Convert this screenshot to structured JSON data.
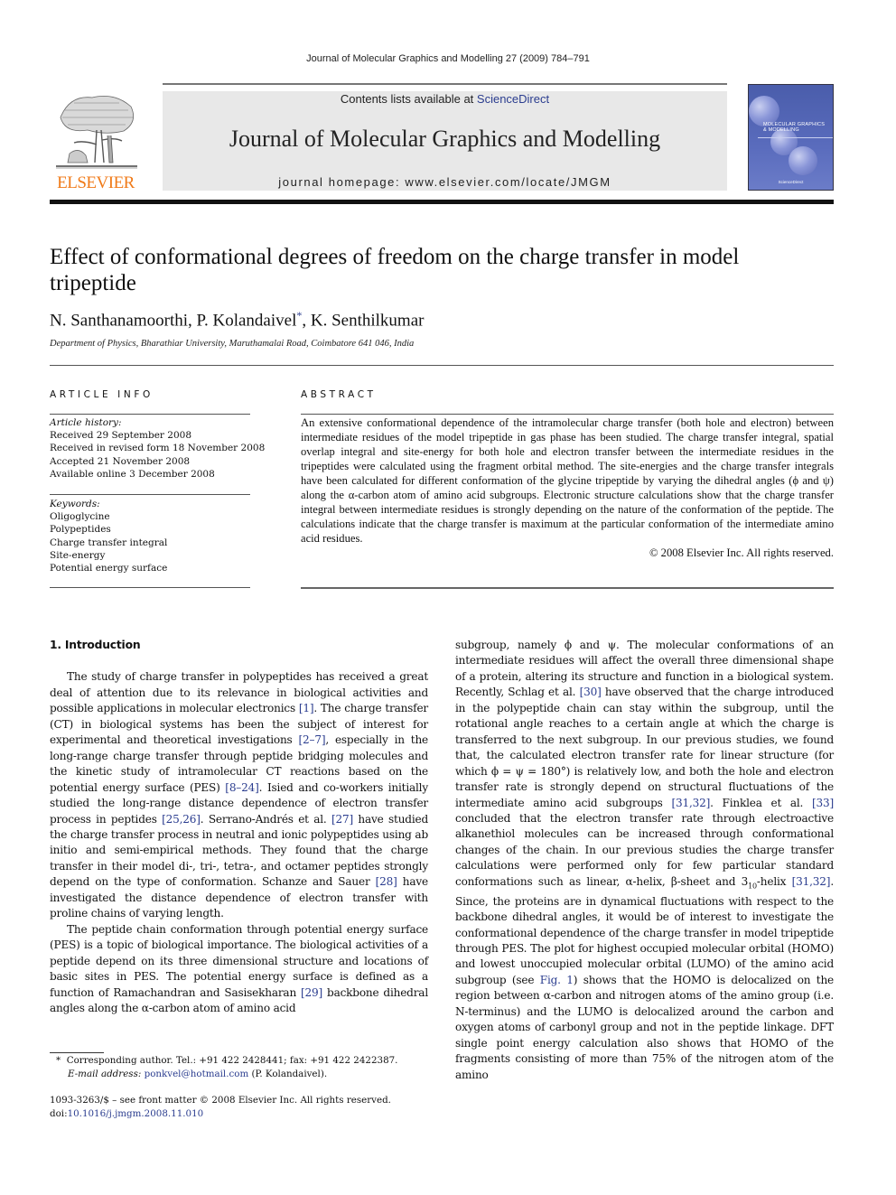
{
  "running_head": "Journal of Molecular Graphics and Modelling 27 (2009) 784–791",
  "publisher": {
    "logo_text": "ELSEVIER",
    "logo_color": "#f07a18"
  },
  "banner": {
    "contents_prefix": "Contents lists available at ",
    "contents_link": "ScienceDirect",
    "journal_title": "Journal of Molecular Graphics and Modelling",
    "homepage": "journal homepage: www.elsevier.com/locate/JMGM"
  },
  "cover": {
    "title_line1": "MOLECULAR GRAPHICS",
    "title_line2": "& MODELLING",
    "footer": "ScienceDirect",
    "color": "#5063b3"
  },
  "article": {
    "title": "Effect of conformational degrees of freedom on the charge transfer in model tripeptide",
    "authors": [
      {
        "name": "N. Santhanamoorthi",
        "sep": ", "
      },
      {
        "name": "P. Kolandaivel",
        "mark": "*",
        "sep": ", "
      },
      {
        "name": "K. Senthilkumar",
        "sep": ""
      }
    ],
    "affiliation": "Department of Physics, Bharathiar University, Maruthamalai Road, Coimbatore 641 046, India"
  },
  "article_info": {
    "label": "ARTICLE INFO",
    "history_label": "Article history:",
    "history": [
      "Received 29 September 2008",
      "Received in revised form 18 November 2008",
      "Accepted 21 November 2008",
      "Available online 3 December 2008"
    ],
    "keywords_label": "Keywords:",
    "keywords": [
      "Oligoglycine",
      "Polypeptides",
      "Charge transfer integral",
      "Site-energy",
      "Potential energy surface"
    ]
  },
  "abstract": {
    "label": "ABSTRACT",
    "text": "An extensive conformational dependence of the intramolecular charge transfer (both hole and electron) between intermediate residues of the model tripeptide in gas phase has been studied. The charge transfer integral, spatial overlap integral and site-energy for both hole and electron transfer between the intermediate residues in the tripeptides were calculated using the fragment orbital method. The site-energies and the charge transfer integrals have been calculated for different conformation of the glycine tripeptide by varying the dihedral angles (ϕ and ψ) along the α-carbon atom of amino acid subgroups. Electronic structure calculations show that the charge transfer integral between intermediate residues is strongly depending on the nature of the conformation of the peptide. The calculations indicate that the charge transfer is maximum at the particular conformation of the intermediate amino acid residues.",
    "copyright": "© 2008 Elsevier Inc. All rights reserved."
  },
  "body": {
    "section_heading": "1.  Introduction",
    "left_col": {
      "p1": [
        {
          "t": "The study of charge transfer in polypeptides has received a great deal of attention due to its relevance in biological activities and possible applications in molecular electronics "
        },
        {
          "t": "[1]",
          "ref": true
        },
        {
          "t": ". The charge transfer (CT) in biological systems has been the subject of interest for experimental and theoretical investigations "
        },
        {
          "t": "[2–7]",
          "ref": true
        },
        {
          "t": ", especially in the long-range charge transfer through peptide bridging molecules and the kinetic study of intramolecular CT reactions based on the potential energy surface (PES) "
        },
        {
          "t": "[8–24]",
          "ref": true
        },
        {
          "t": ". Isied and co-workers initially studied the long-range distance dependence of electron transfer process in peptides "
        },
        {
          "t": "[25,26]",
          "ref": true
        },
        {
          "t": ". Serrano-Andrés et al. "
        },
        {
          "t": "[27]",
          "ref": true
        },
        {
          "t": " have studied the charge transfer process in neutral and ionic polypeptides using ab initio and semi-empirical methods. They found that the charge transfer in their model di-, tri-, tetra-, and octamer peptides strongly depend on the type of conformation. Schanze and Sauer "
        },
        {
          "t": "[28]",
          "ref": true
        },
        {
          "t": " have investigated the distance dependence of electron transfer with proline chains of varying length."
        }
      ],
      "p2": [
        {
          "t": "The peptide chain conformation through potential energy surface (PES) is a topic of biological importance. The biological activities of a peptide depend on its three dimensional structure and locations of basic sites in PES. The potential energy surface is defined as a function of Ramachandran and Sasisekharan "
        },
        {
          "t": "[29]",
          "ref": true
        },
        {
          "t": " backbone dihedral angles along the α-carbon atom of amino acid"
        }
      ]
    },
    "right_col": {
      "p1": [
        {
          "t": "subgroup, namely ϕ and ψ. The molecular conformations of an intermediate residues will affect the overall three dimensional shape of a protein, altering its structure and function in a biological system. Recently, Schlag et al. "
        },
        {
          "t": "[30]",
          "ref": true
        },
        {
          "t": " have observed that the charge introduced in the polypeptide chain can stay within the subgroup, until the rotational angle reaches to a certain angle at which the charge is transferred to the next subgroup. In our previous studies, we found that, the calculated electron transfer rate for linear structure (for which ϕ = ψ = 180°) is relatively low, and both the hole and electron transfer rate is strongly depend on structural fluctuations of the intermediate amino acid subgroups "
        },
        {
          "t": "[31,32]",
          "ref": true
        },
        {
          "t": ". Finklea et al. "
        },
        {
          "t": "[33]",
          "ref": true
        },
        {
          "t": " concluded that the electron transfer rate through electroactive alkanethiol molecules can be increased through conformational changes of the chain. In our previous studies the charge transfer calculations were performed only for few particular standard conformations such as linear, α-helix, β-sheet and 3"
        },
        {
          "t": "10",
          "sub": true
        },
        {
          "t": "-helix "
        },
        {
          "t": "[31,32]",
          "ref": true
        },
        {
          "t": ". Since, the proteins are in dynamical fluctuations with respect to the backbone dihedral angles, it would be of interest to investigate the conformational dependence of the charge transfer in model tripeptide through PES. The plot for highest occupied molecular orbital (HOMO) and lowest unoccupied molecular orbital (LUMO) of the amino acid subgroup (see "
        },
        {
          "t": "Fig. 1",
          "ref": true
        },
        {
          "t": ") shows that the HOMO is delocalized on the region between α-carbon and nitrogen atoms of the amino group (i.e. N-terminus) and the LUMO is delocalized around the carbon and oxygen atoms of carbonyl group and not in the peptide linkage. DFT single point energy calculation also shows that HOMO of the fragments consisting of more than 75% of the nitrogen atom of the amino"
        }
      ]
    }
  },
  "footnote": {
    "mark": "*",
    "corresponding": "Corresponding author. Tel.: +91 422 2428441; fax: +91 422 2422387.",
    "email_label": "E-mail address: ",
    "email": "ponkvel@hotmail.com",
    "email_suffix": " (P. Kolandaivel)."
  },
  "front_matter": {
    "issn_line": "1093-3263/$ – see front matter © 2008 Elsevier Inc. All rights reserved.",
    "doi_prefix": "doi:",
    "doi": "10.1016/j.jmgm.2008.11.010"
  },
  "colors": {
    "link": "#2b3d8f",
    "banner_bg": "#e8e8e8"
  }
}
